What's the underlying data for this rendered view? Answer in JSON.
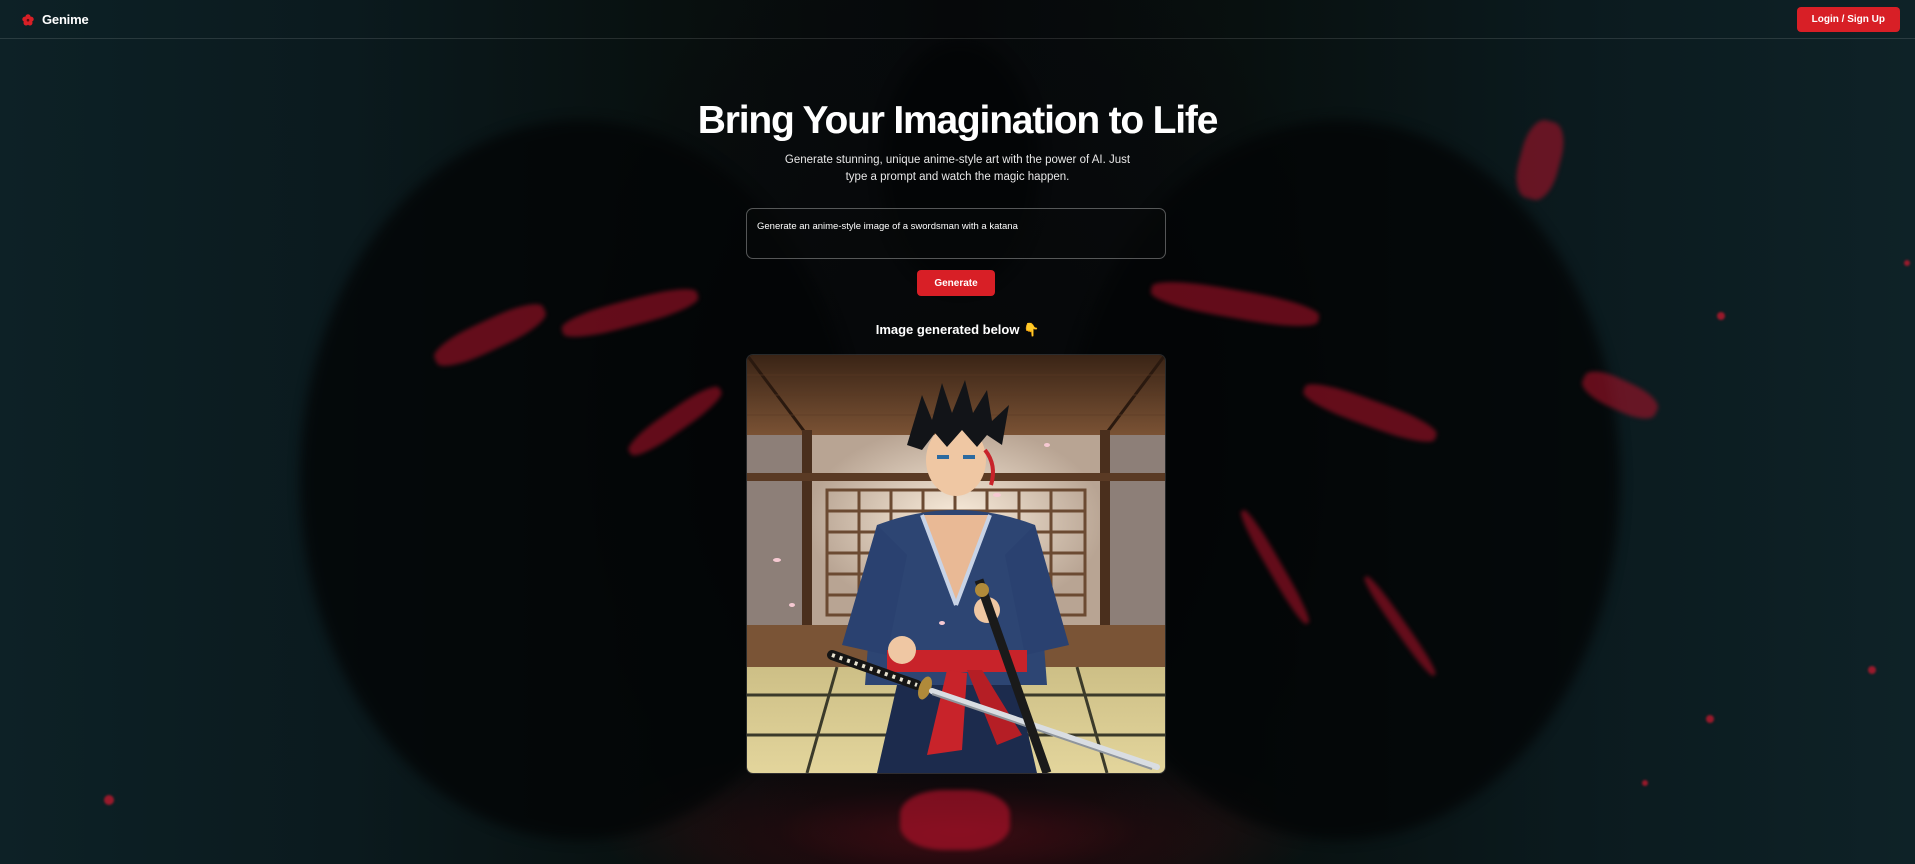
{
  "app": {
    "brand": "Genime"
  },
  "header": {
    "login_label": "Login / Sign Up"
  },
  "hero": {
    "title": "Bring Your Imagination to Life",
    "subtitle": "Generate stunning, unique anime-style art with the power of AI. Just type a prompt and watch the magic happen."
  },
  "prompt": {
    "value": "Generate an anime-style image of a swordsman with a katana"
  },
  "generate": {
    "label": "Generate"
  },
  "result": {
    "label": "Image generated below",
    "emoji": "👇"
  },
  "colors": {
    "accent": "#d81f26",
    "background": "#0b1216"
  },
  "icons": {
    "brand": "red-flower-logo-icon"
  }
}
